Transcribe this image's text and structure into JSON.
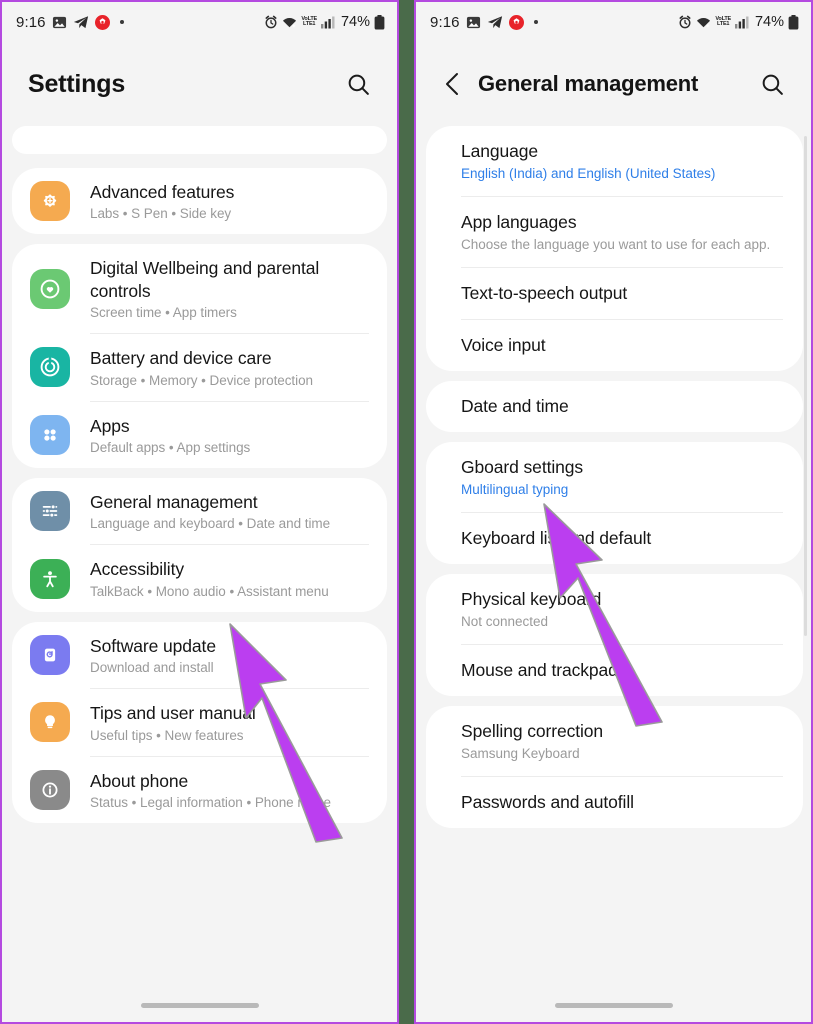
{
  "status_bar": {
    "time": "9:16",
    "battery_percent": "74%",
    "network_label_top": "VoLTE",
    "network_label_bottom": "LTE1",
    "icons": [
      "gallery-icon",
      "telegram-icon",
      "app-notification-icon",
      "notification-dot",
      "alarm-icon",
      "wifi-icon",
      "volte-icon",
      "signal-icon",
      "battery-icon"
    ]
  },
  "left_panel": {
    "header": {
      "title": "Settings",
      "search_label": "Search"
    },
    "groups": [
      {
        "id": "stub",
        "items": []
      },
      {
        "id": "advanced",
        "items": [
          {
            "title": "Advanced features",
            "subtitle": "Labs  •  S Pen  •  Side key",
            "icon": "gear-icon",
            "icon_color": "#f5aa50"
          }
        ]
      },
      {
        "id": "wellbeing",
        "items": [
          {
            "title": "Digital Wellbeing and parental controls",
            "subtitle": "Screen time  •  App timers",
            "icon": "heart-circle-icon",
            "icon_color": "#6bc973"
          },
          {
            "title": "Battery and device care",
            "subtitle": "Storage  •  Memory  •  Device protection",
            "icon": "battery-care-icon",
            "icon_color": "#19b5a3"
          },
          {
            "title": "Apps",
            "subtitle": "Default apps  •  App settings",
            "icon": "apps-grid-icon",
            "icon_color": "#7eb5f0"
          }
        ]
      },
      {
        "id": "general",
        "items": [
          {
            "title": "General management",
            "subtitle": "Language and keyboard  •  Date and time",
            "icon": "sliders-icon",
            "icon_color": "#6f8fa8"
          },
          {
            "title": "Accessibility",
            "subtitle": "TalkBack  •  Mono audio  •  Assistant menu",
            "icon": "accessibility-icon",
            "icon_color": "#3cb056"
          }
        ]
      },
      {
        "id": "about",
        "items": [
          {
            "title": "Software update",
            "subtitle": "Download and install",
            "icon": "software-update-icon",
            "icon_color": "#7b7bf0"
          },
          {
            "title": "Tips and user manual",
            "subtitle": "Useful tips  •  New features",
            "icon": "lightbulb-icon",
            "icon_color": "#f5aa50"
          },
          {
            "title": "About phone",
            "subtitle": "Status  •  Legal information  •  Phone name",
            "icon": "info-icon",
            "icon_color": "#8a8a8a"
          }
        ]
      }
    ]
  },
  "right_panel": {
    "header": {
      "title": "General management",
      "back_label": "Back",
      "search_label": "Search"
    },
    "groups": [
      {
        "id": "language-group",
        "items": [
          {
            "title": "Language",
            "subtitle": "English (India) and English (United States)",
            "subtitle_style": "link"
          },
          {
            "title": "App languages",
            "subtitle": "Choose the language you want to use for each app.",
            "subtitle_style": "muted"
          },
          {
            "title": "Text-to-speech output",
            "subtitle": "",
            "subtitle_style": "none"
          },
          {
            "title": "Voice input",
            "subtitle": "",
            "subtitle_style": "none"
          }
        ]
      },
      {
        "id": "datetime-group",
        "items": [
          {
            "title": "Date and time",
            "subtitle": "",
            "subtitle_style": "none"
          }
        ]
      },
      {
        "id": "keyboard-group",
        "items": [
          {
            "title": "Gboard settings",
            "subtitle": "Multilingual typing",
            "subtitle_style": "link"
          },
          {
            "title": "Keyboard list and default",
            "subtitle": "",
            "subtitle_style": "none"
          }
        ]
      },
      {
        "id": "physical-group",
        "items": [
          {
            "title": "Physical keyboard",
            "subtitle": "Not connected",
            "subtitle_style": "muted"
          },
          {
            "title": "Mouse and trackpad",
            "subtitle": "",
            "subtitle_style": "none"
          }
        ]
      },
      {
        "id": "spelling-group",
        "items": [
          {
            "title": "Spelling correction",
            "subtitle": "Samsung Keyboard",
            "subtitle_style": "muted"
          },
          {
            "title": "Passwords and autofill",
            "subtitle": "",
            "subtitle_style": "none"
          }
        ]
      }
    ]
  },
  "annotations": {
    "cursor_color": "#bb3ef0",
    "cursors": [
      {
        "name": "left-cursor-arrow",
        "points_at": "General management"
      },
      {
        "name": "right-cursor-arrow",
        "points_at": "Date and time"
      }
    ]
  },
  "theme": {
    "border_color": "#b44ae0",
    "divider_strip_color": "#4a6b4a",
    "page_bg": "#f4f4f4",
    "card_bg": "#ffffff",
    "link_color": "#2f7fe8",
    "muted_text": "#9a9a9a"
  }
}
